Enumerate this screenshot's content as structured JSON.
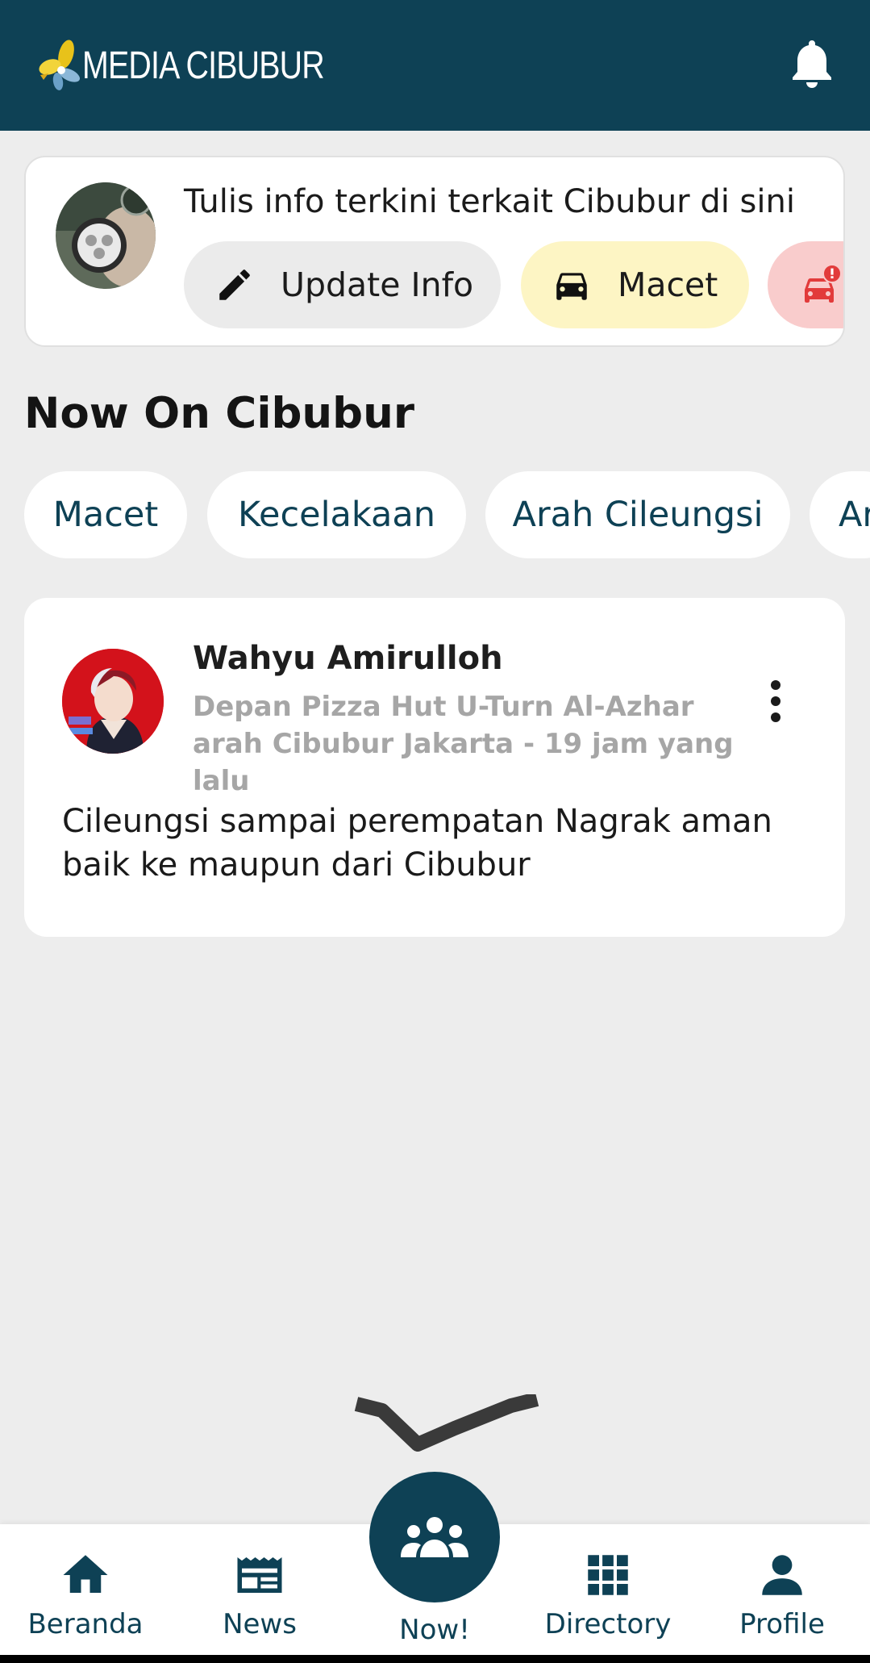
{
  "app": {
    "brand_name": "MEDIA CIBUBUR",
    "colors": {
      "primary": "#0e4155",
      "background": "#ededed",
      "macet_pill": "#fdf5c4",
      "accident_pill": "#f9cccc"
    }
  },
  "header": {
    "logo_icon": "flower-logo-icon",
    "notification_icon": "bell-icon"
  },
  "composer": {
    "prompt": "Tulis info terkini terkait Cibubur di sini",
    "actions": [
      {
        "label": "Update Info",
        "icon": "pencil-icon"
      },
      {
        "label": "Macet",
        "icon": "car-icon"
      },
      {
        "label": "",
        "icon": "car-alert-icon"
      }
    ]
  },
  "now_section": {
    "title": "Now On Cibubur",
    "chips": [
      "Macet",
      "Kecelakaan",
      "Arah Cileungsi",
      "Ar"
    ]
  },
  "post": {
    "author": "Wahyu Amirulloh",
    "location_time": "Depan Pizza Hut U-Turn Al-Azhar arah Cibubur Jakarta - 19 jam yang lalu",
    "body": "Cileungsi sampai perempatan Nagrak aman baik ke maupun dari Cibubur",
    "menu_icon": "more-vertical-icon"
  },
  "bottom_nav": {
    "items": [
      {
        "label": "Beranda",
        "icon": "home-icon"
      },
      {
        "label": "News",
        "icon": "newspaper-icon"
      },
      {
        "label": "Now!",
        "icon": "people-group-icon"
      },
      {
        "label": "Directory",
        "icon": "grid-icon"
      },
      {
        "label": "Profile",
        "icon": "person-icon"
      }
    ]
  }
}
